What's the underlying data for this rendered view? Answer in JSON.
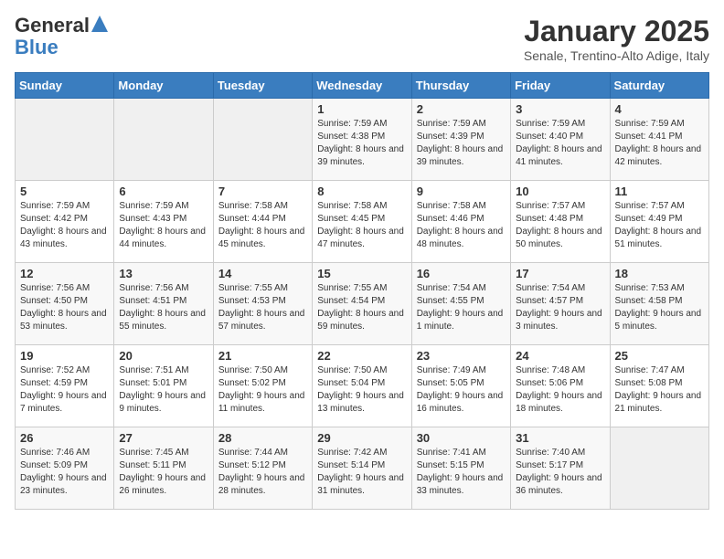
{
  "logo": {
    "line1": "General",
    "line2": "Blue"
  },
  "header": {
    "month": "January 2025",
    "location": "Senale, Trentino-Alto Adige, Italy"
  },
  "weekdays": [
    "Sunday",
    "Monday",
    "Tuesday",
    "Wednesday",
    "Thursday",
    "Friday",
    "Saturday"
  ],
  "weeks": [
    [
      {
        "day": "",
        "info": ""
      },
      {
        "day": "",
        "info": ""
      },
      {
        "day": "",
        "info": ""
      },
      {
        "day": "1",
        "info": "Sunrise: 7:59 AM\nSunset: 4:38 PM\nDaylight: 8 hours and 39 minutes."
      },
      {
        "day": "2",
        "info": "Sunrise: 7:59 AM\nSunset: 4:39 PM\nDaylight: 8 hours and 39 minutes."
      },
      {
        "day": "3",
        "info": "Sunrise: 7:59 AM\nSunset: 4:40 PM\nDaylight: 8 hours and 41 minutes."
      },
      {
        "day": "4",
        "info": "Sunrise: 7:59 AM\nSunset: 4:41 PM\nDaylight: 8 hours and 42 minutes."
      }
    ],
    [
      {
        "day": "5",
        "info": "Sunrise: 7:59 AM\nSunset: 4:42 PM\nDaylight: 8 hours and 43 minutes."
      },
      {
        "day": "6",
        "info": "Sunrise: 7:59 AM\nSunset: 4:43 PM\nDaylight: 8 hours and 44 minutes."
      },
      {
        "day": "7",
        "info": "Sunrise: 7:58 AM\nSunset: 4:44 PM\nDaylight: 8 hours and 45 minutes."
      },
      {
        "day": "8",
        "info": "Sunrise: 7:58 AM\nSunset: 4:45 PM\nDaylight: 8 hours and 47 minutes."
      },
      {
        "day": "9",
        "info": "Sunrise: 7:58 AM\nSunset: 4:46 PM\nDaylight: 8 hours and 48 minutes."
      },
      {
        "day": "10",
        "info": "Sunrise: 7:57 AM\nSunset: 4:48 PM\nDaylight: 8 hours and 50 minutes."
      },
      {
        "day": "11",
        "info": "Sunrise: 7:57 AM\nSunset: 4:49 PM\nDaylight: 8 hours and 51 minutes."
      }
    ],
    [
      {
        "day": "12",
        "info": "Sunrise: 7:56 AM\nSunset: 4:50 PM\nDaylight: 8 hours and 53 minutes."
      },
      {
        "day": "13",
        "info": "Sunrise: 7:56 AM\nSunset: 4:51 PM\nDaylight: 8 hours and 55 minutes."
      },
      {
        "day": "14",
        "info": "Sunrise: 7:55 AM\nSunset: 4:53 PM\nDaylight: 8 hours and 57 minutes."
      },
      {
        "day": "15",
        "info": "Sunrise: 7:55 AM\nSunset: 4:54 PM\nDaylight: 8 hours and 59 minutes."
      },
      {
        "day": "16",
        "info": "Sunrise: 7:54 AM\nSunset: 4:55 PM\nDaylight: 9 hours and 1 minute."
      },
      {
        "day": "17",
        "info": "Sunrise: 7:54 AM\nSunset: 4:57 PM\nDaylight: 9 hours and 3 minutes."
      },
      {
        "day": "18",
        "info": "Sunrise: 7:53 AM\nSunset: 4:58 PM\nDaylight: 9 hours and 5 minutes."
      }
    ],
    [
      {
        "day": "19",
        "info": "Sunrise: 7:52 AM\nSunset: 4:59 PM\nDaylight: 9 hours and 7 minutes."
      },
      {
        "day": "20",
        "info": "Sunrise: 7:51 AM\nSunset: 5:01 PM\nDaylight: 9 hours and 9 minutes."
      },
      {
        "day": "21",
        "info": "Sunrise: 7:50 AM\nSunset: 5:02 PM\nDaylight: 9 hours and 11 minutes."
      },
      {
        "day": "22",
        "info": "Sunrise: 7:50 AM\nSunset: 5:04 PM\nDaylight: 9 hours and 13 minutes."
      },
      {
        "day": "23",
        "info": "Sunrise: 7:49 AM\nSunset: 5:05 PM\nDaylight: 9 hours and 16 minutes."
      },
      {
        "day": "24",
        "info": "Sunrise: 7:48 AM\nSunset: 5:06 PM\nDaylight: 9 hours and 18 minutes."
      },
      {
        "day": "25",
        "info": "Sunrise: 7:47 AM\nSunset: 5:08 PM\nDaylight: 9 hours and 21 minutes."
      }
    ],
    [
      {
        "day": "26",
        "info": "Sunrise: 7:46 AM\nSunset: 5:09 PM\nDaylight: 9 hours and 23 minutes."
      },
      {
        "day": "27",
        "info": "Sunrise: 7:45 AM\nSunset: 5:11 PM\nDaylight: 9 hours and 26 minutes."
      },
      {
        "day": "28",
        "info": "Sunrise: 7:44 AM\nSunset: 5:12 PM\nDaylight: 9 hours and 28 minutes."
      },
      {
        "day": "29",
        "info": "Sunrise: 7:42 AM\nSunset: 5:14 PM\nDaylight: 9 hours and 31 minutes."
      },
      {
        "day": "30",
        "info": "Sunrise: 7:41 AM\nSunset: 5:15 PM\nDaylight: 9 hours and 33 minutes."
      },
      {
        "day": "31",
        "info": "Sunrise: 7:40 AM\nSunset: 5:17 PM\nDaylight: 9 hours and 36 minutes."
      },
      {
        "day": "",
        "info": ""
      }
    ]
  ]
}
